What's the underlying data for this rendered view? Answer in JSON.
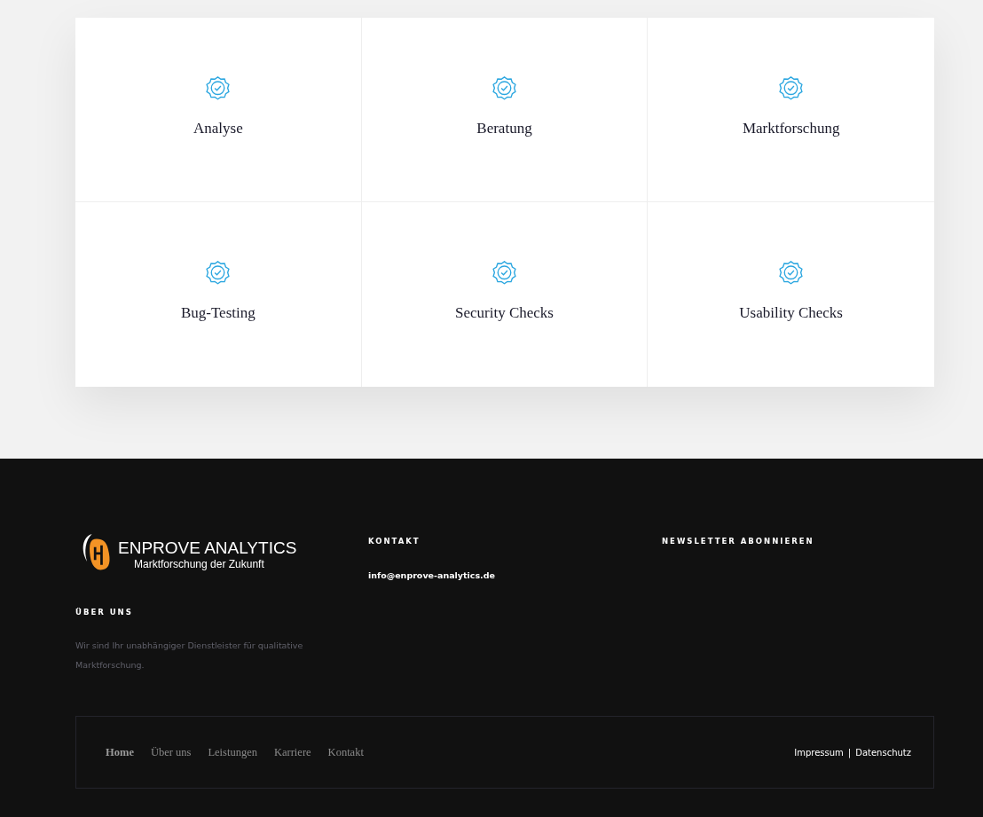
{
  "services": [
    {
      "title": "Analyse"
    },
    {
      "title": "Beratung"
    },
    {
      "title": "Marktforschung"
    },
    {
      "title": "Bug-Testing"
    },
    {
      "title": "Security Checks"
    },
    {
      "title": "Usability Checks"
    }
  ],
  "footer": {
    "logo": {
      "name": "ENPROVE ANALYTICS",
      "tagline": "Marktforschung der Zukunft"
    },
    "about": {
      "heading": "ÜBER UNS",
      "text": "Wir sind Ihr unabhängiger Dienstleister für qualitative Marktforschung."
    },
    "contact": {
      "heading": "KONTAKT",
      "email": "info@enprove-analytics.de"
    },
    "newsletter": {
      "heading": "NEWSLETTER ABONNIEREN"
    },
    "nav": [
      {
        "label": "Home",
        "selected": true
      },
      {
        "label": "Über uns",
        "selected": false
      },
      {
        "label": "Leistungen",
        "selected": false
      },
      {
        "label": "Karriere",
        "selected": false
      },
      {
        "label": "Kontakt",
        "selected": false
      }
    ],
    "legal": {
      "links": [
        "Impressum",
        "Datenschutz"
      ],
      "separator": "|"
    }
  }
}
